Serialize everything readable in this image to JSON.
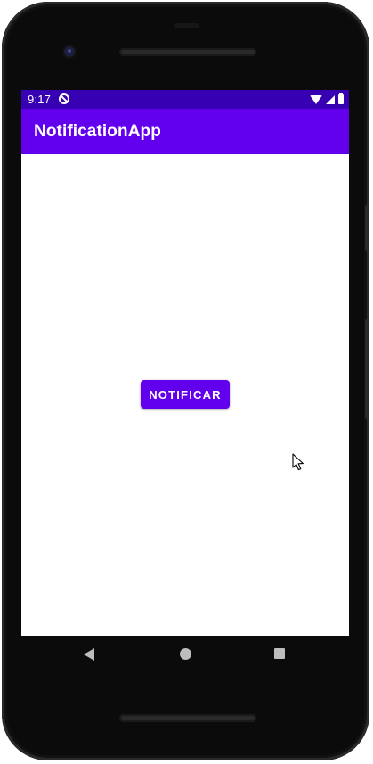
{
  "status_bar": {
    "time": "9:17",
    "background": "#3700b3",
    "icons": [
      "notification-icon",
      "wifi-icon",
      "signal-icon",
      "battery-icon"
    ]
  },
  "app_bar": {
    "title": "NotificationApp",
    "background": "#6200ee"
  },
  "main": {
    "notify_button_label": "NOTIFICAR",
    "button_color": "#6200ee"
  },
  "nav_bar": {
    "buttons": [
      "back-icon",
      "home-icon",
      "recents-icon"
    ]
  }
}
